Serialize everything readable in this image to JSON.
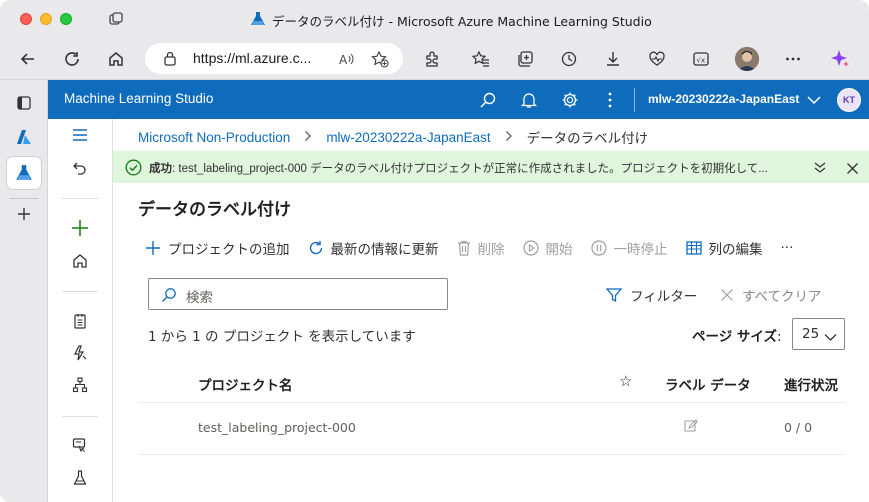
{
  "browser": {
    "window_title": "データのラベル付け - Microsoft Azure Machine Learning Studio",
    "url": "https://ml.azure.c..."
  },
  "header": {
    "app_title": "Machine Learning Studio",
    "workspace": "mlw-20230222a-JapanEast",
    "user_initials": "KT"
  },
  "breadcrumb": {
    "items": [
      "Microsoft Non-Production",
      "mlw-20230222a-JapanEast",
      "データのラベル付け"
    ]
  },
  "banner": {
    "status": "成功",
    "message": ": test_labeling_project-000 データのラベル付けプロジェクトが正常に作成されました。プロジェクトを初期化して..."
  },
  "page": {
    "title": "データのラベル付け"
  },
  "commands": {
    "add": "プロジェクトの追加",
    "refresh": "最新の情報に更新",
    "delete": "削除",
    "start": "開始",
    "pause": "一時停止",
    "edit_columns": "列の編集",
    "more": "···"
  },
  "search": {
    "placeholder": "検索"
  },
  "filter": {
    "filter_label": "フィルター",
    "clear_label": "すべてクリア"
  },
  "listing": {
    "count_text": "1 から 1 の プロジェクト を表示しています",
    "page_size_label": "ページ サイズ",
    "page_size_colon": ":",
    "page_size_value": "25"
  },
  "table": {
    "headers": {
      "name": "プロジェクト名",
      "star": "☆",
      "label_data": "ラベル データ",
      "progress": "進行状況"
    },
    "rows": [
      {
        "name": "test_labeling_project-000",
        "progress": "0 / 0"
      }
    ]
  },
  "colors": {
    "azure_blue": "#0f6cbd",
    "success_bg": "#dff6dd",
    "success_green": "#107c10"
  }
}
